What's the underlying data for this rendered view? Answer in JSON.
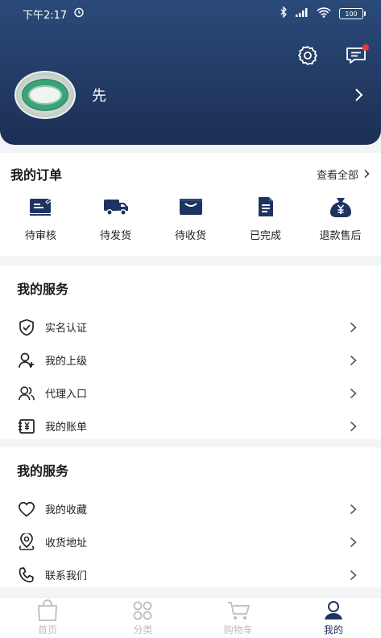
{
  "status_bar": {
    "time": "下午2:17",
    "battery": "100"
  },
  "profile": {
    "username": "先"
  },
  "orders": {
    "title": "我的订单",
    "view_all": "查看全部",
    "items": [
      {
        "label": "待审核",
        "icon": "review-icon"
      },
      {
        "label": "待发货",
        "icon": "truck-icon"
      },
      {
        "label": "待收货",
        "icon": "box-icon"
      },
      {
        "label": "已完成",
        "icon": "document-icon"
      },
      {
        "label": "退款售后",
        "icon": "money-bag-icon"
      }
    ]
  },
  "services": [
    {
      "title": "我的服务",
      "items": [
        {
          "label": "实名认证",
          "icon": "shield-icon"
        },
        {
          "label": "我的上级",
          "icon": "user-add-icon"
        },
        {
          "label": "代理入口",
          "icon": "users-icon"
        },
        {
          "label": "我的账单",
          "icon": "bill-icon"
        }
      ]
    },
    {
      "title": "我的服务",
      "items": [
        {
          "label": "我的收藏",
          "icon": "heart-icon"
        },
        {
          "label": "收货地址",
          "icon": "location-icon"
        },
        {
          "label": "联系我们",
          "icon": "phone-icon"
        }
      ]
    }
  ],
  "tabbar": {
    "items": [
      {
        "label": "首页",
        "icon": "bag-icon",
        "active": false
      },
      {
        "label": "分类",
        "icon": "grid-icon",
        "active": false
      },
      {
        "label": "购物车",
        "icon": "cart-icon",
        "active": false
      },
      {
        "label": "我的",
        "icon": "profile-icon",
        "active": true
      }
    ]
  },
  "colors": {
    "header_top": "#2b4a79",
    "header_bottom": "#1c2f55",
    "accent": "#1d3461",
    "tab_inactive": "#bdbdbd",
    "notification_dot": "#e53935"
  }
}
